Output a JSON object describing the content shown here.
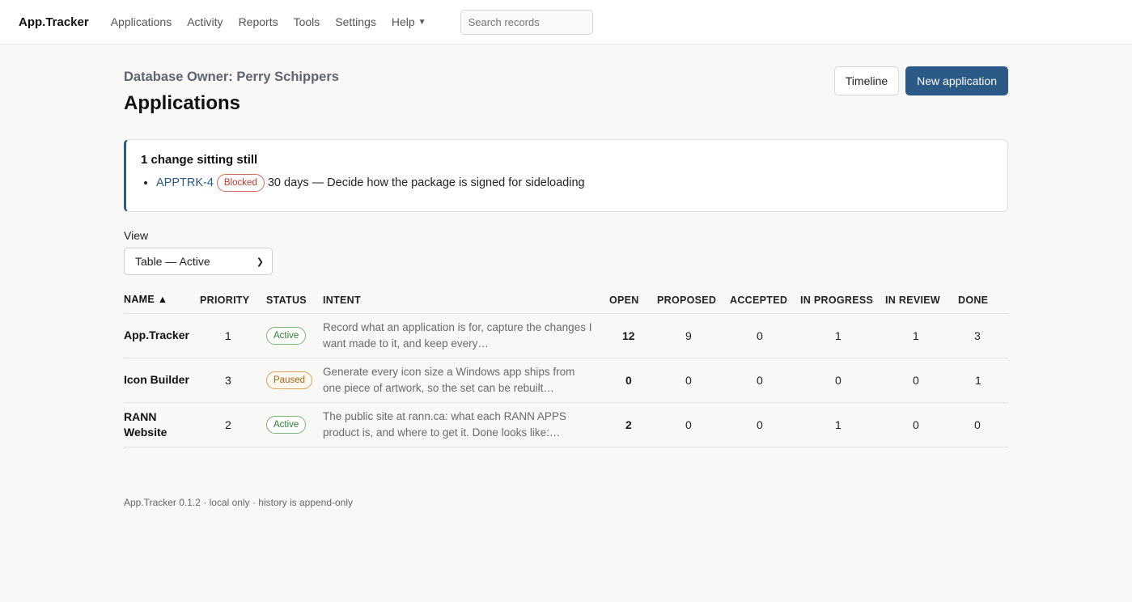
{
  "nav": {
    "brand": "App.Tracker",
    "links": [
      "Applications",
      "Activity",
      "Reports",
      "Tools",
      "Settings"
    ],
    "help": "Help",
    "search_placeholder": "Search records"
  },
  "header": {
    "owner": "Database Owner: Perry Schippers",
    "title": "Applications",
    "timeline_button": "Timeline",
    "new_button": "New application"
  },
  "alert": {
    "title": "1 change sitting still",
    "item": {
      "id": "APPTRK-4",
      "badge": "Blocked",
      "text": "30 days — Decide how the package is signed for sideloading"
    }
  },
  "view": {
    "label": "View",
    "selected": "Table — Active"
  },
  "table": {
    "headers": [
      "NAME ▲",
      "PRIORITY",
      "STATUS",
      "INTENT",
      "OPEN",
      "PROPOSED",
      "ACCEPTED",
      "IN PROGRESS",
      "IN REVIEW",
      "DONE"
    ],
    "rows": [
      {
        "name": "App.Tracker",
        "priority": "1",
        "status": "Active",
        "intent": "Record what an application is for, capture the changes I want made to it, and keep every…",
        "open": "12",
        "proposed": "9",
        "accepted": "0",
        "in_progress": "1",
        "in_review": "1",
        "done": "3"
      },
      {
        "name": "Icon Builder",
        "priority": "3",
        "status": "Paused",
        "intent": "Generate every icon size a Windows app ships from one piece of artwork, so the set can be rebuilt…",
        "open": "0",
        "proposed": "0",
        "accepted": "0",
        "in_progress": "0",
        "in_review": "0",
        "done": "1"
      },
      {
        "name": "RANN Website",
        "priority": "2",
        "status": "Active",
        "intent": "The public site at rann.ca: what each RANN APPS product is, and where to get it. Done looks like:…",
        "open": "2",
        "proposed": "0",
        "accepted": "0",
        "in_progress": "1",
        "in_review": "0",
        "done": "0"
      }
    ]
  },
  "footer": "App.Tracker 0.1.2 · local only · history is append-only",
  "colors": {
    "accent": "#2b5a87",
    "active": "#2e7d32",
    "paused": "#a8661a",
    "blocked": "#c0392b"
  }
}
